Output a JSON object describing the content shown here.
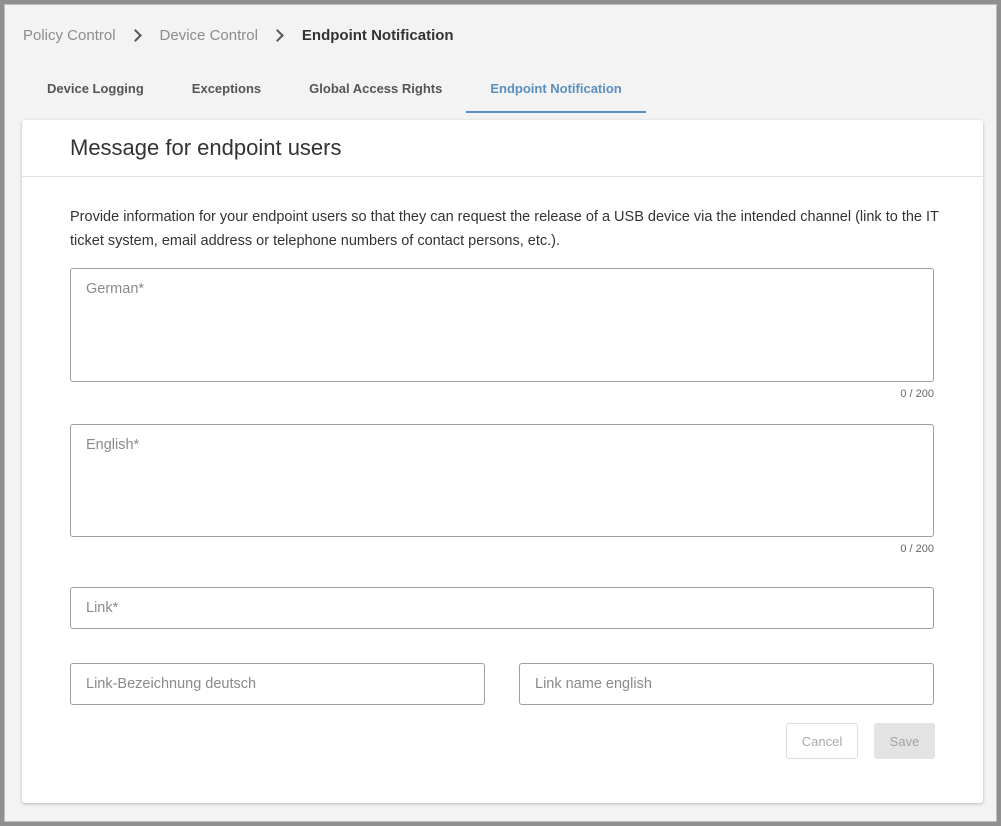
{
  "breadcrumb": {
    "items": [
      "Policy Control",
      "Device Control",
      "Endpoint Notification"
    ]
  },
  "tabs": [
    {
      "label": "Device Logging",
      "active": false
    },
    {
      "label": "Exceptions",
      "active": false
    },
    {
      "label": "Global Access Rights",
      "active": false
    },
    {
      "label": "Endpoint Notification",
      "active": true
    }
  ],
  "card": {
    "title": "Message for endpoint users",
    "description": "Provide information for your endpoint users so that they can request the release of a USB device via the intended channel (link to the IT ticket system, email address or telephone numbers of contact persons, etc.).",
    "german": {
      "placeholder": "German*",
      "value": "",
      "counter": "0 / 200"
    },
    "english": {
      "placeholder": "English*",
      "value": "",
      "counter": "0 / 200"
    },
    "link": {
      "placeholder": "Link*",
      "value": ""
    },
    "link_name_de": {
      "placeholder": "Link-Bezeichnung deutsch",
      "value": ""
    },
    "link_name_en": {
      "placeholder": "Link name english",
      "value": ""
    },
    "cancel_label": "Cancel",
    "save_label": "Save"
  },
  "colors": {
    "accent": "#5a8ec1",
    "text": "#333333",
    "muted": "#8a8a8a"
  }
}
